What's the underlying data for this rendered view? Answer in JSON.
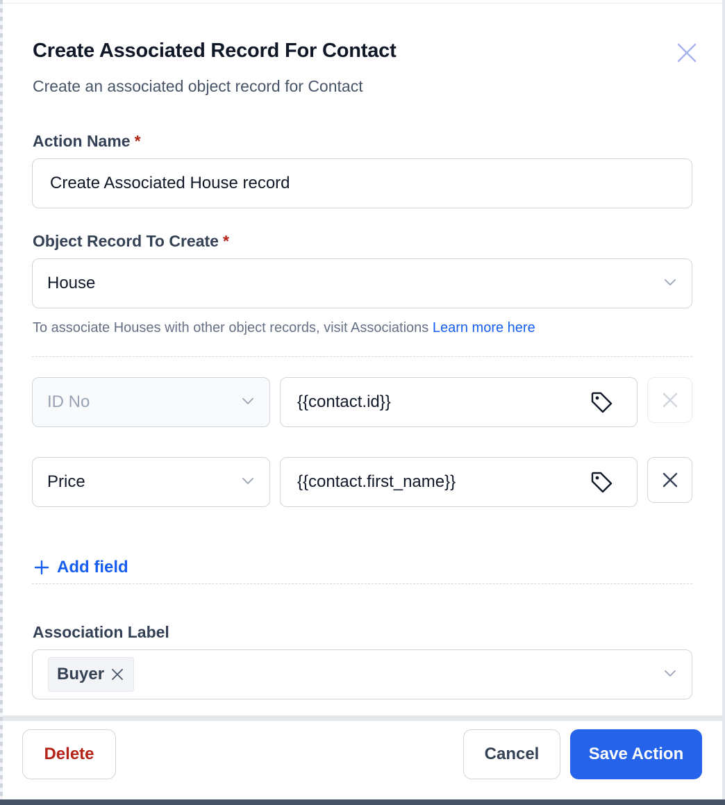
{
  "dialog": {
    "title": "Create Associated Record For Contact",
    "subtitle": "Create an associated object record for Contact"
  },
  "action_name": {
    "label": "Action Name",
    "required_mark": "*",
    "value": "Create Associated House record"
  },
  "object_record": {
    "label": "Object Record To Create",
    "required_mark": "*",
    "selected": "House",
    "hint_text": "To associate Houses with other object records, visit Associations",
    "hint_link": "Learn more here"
  },
  "field_rows": [
    {
      "field": "ID No",
      "value": "{{contact.id}}",
      "disabled": true
    },
    {
      "field": "Price",
      "value": "{{contact.first_name}}",
      "disabled": false
    }
  ],
  "add_field": {
    "label": "Add field"
  },
  "association": {
    "label": "Association Label",
    "chips": [
      "Buyer"
    ]
  },
  "footer": {
    "delete_label": "Delete",
    "cancel_label": "Cancel",
    "save_label": "Save Action"
  },
  "colors": {
    "primary": "#2563eb",
    "danger": "#b42318",
    "link": "#155eef"
  },
  "icons": {
    "close": "close-icon",
    "chevron": "chevron-down-icon",
    "tag": "tag-icon",
    "remove": "remove-icon",
    "plus": "plus-icon"
  }
}
